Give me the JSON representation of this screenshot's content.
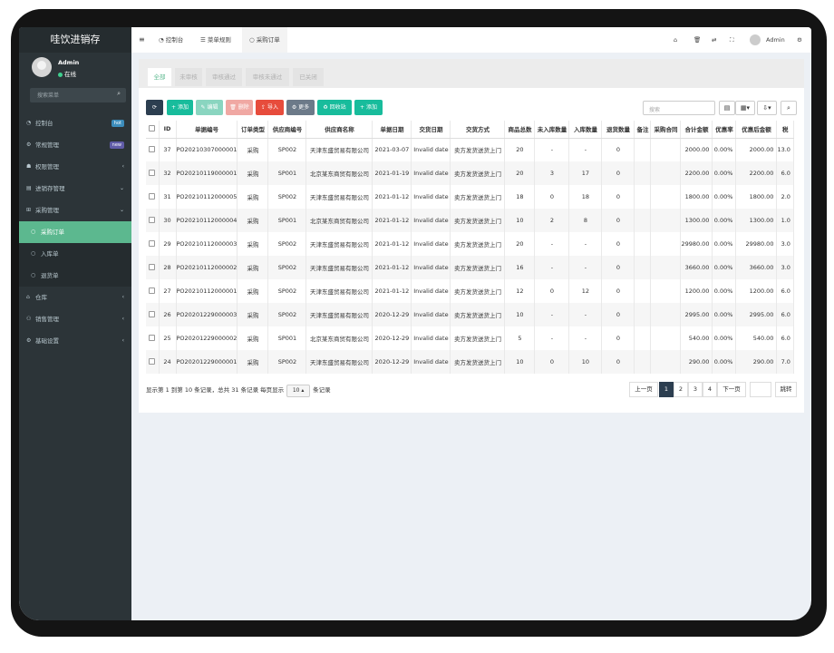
{
  "app": {
    "title": "哇饮进销存"
  },
  "user": {
    "name": "Admin",
    "status": "在线"
  },
  "sidebar": {
    "search_placeholder": "搜索菜单",
    "items": [
      {
        "label": "控制台",
        "badge": "hot",
        "badge_color": "#3c8dbc"
      },
      {
        "label": "常规管理",
        "badge": "new",
        "badge_color": "#605ca8"
      },
      {
        "label": "权限管理",
        "arrow": "‹"
      },
      {
        "label": "进销存管理",
        "arrow": "⌄"
      },
      {
        "label": "采购管理",
        "arrow": "⌄"
      }
    ],
    "subitems": [
      {
        "label": "采购订单"
      },
      {
        "label": "入库单"
      },
      {
        "label": "退货单"
      }
    ],
    "items2": [
      {
        "label": "仓库",
        "arrow": "‹"
      },
      {
        "label": "销售管理",
        "arrow": "‹"
      },
      {
        "label": "基础设置",
        "arrow": "‹"
      }
    ]
  },
  "topbar": {
    "menu_icon": "≡",
    "tabs": [
      "控制台",
      "菜单规则",
      "采购订单"
    ],
    "user": "Admin"
  },
  "filter_tabs": [
    "全部",
    "未审核",
    "审核通过",
    "审核未通过",
    "已关闭"
  ],
  "toolbar": {
    "buttons": [
      {
        "label": "",
        "icon": "refresh-icon",
        "color": "#2c3e50"
      },
      {
        "label": "添加",
        "icon": "+",
        "color": "#18bc9c"
      },
      {
        "label": "编辑",
        "icon": "✎",
        "color": "#8ad5c0"
      },
      {
        "label": "删除",
        "icon": "🗑",
        "color": "#f0a8a3"
      },
      {
        "label": "导入",
        "icon": "⇪",
        "color": "#e74c3c"
      },
      {
        "label": "更多",
        "icon": "⚙",
        "color": "#6c7a89"
      },
      {
        "label": "回收站",
        "icon": "♻",
        "color": "#18bc9c"
      },
      {
        "label": "添加",
        "icon": "+",
        "color": "#18bc9c"
      }
    ],
    "search_placeholder": "搜索"
  },
  "table": {
    "columns": [
      "ID",
      "单据编号",
      "订单类型",
      "供应商编号",
      "供应商名称",
      "单据日期",
      "交货日期",
      "交货方式",
      "商品总数",
      "未入库数量",
      "入库数量",
      "退货数量",
      "备注",
      "采购合同",
      "合计金额",
      "优惠率",
      "优惠后金额",
      "税"
    ],
    "rows": [
      [
        "37",
        "PO20210307000001",
        "采购",
        "SP002",
        "天津东盛贸易有限公司",
        "2021-03-07",
        "Invalid date",
        "卖方发货送货上门",
        "20",
        "-",
        "-",
        "0",
        "",
        "",
        "2000.00",
        "0.00%",
        "2000.00",
        "13.0"
      ],
      [
        "32",
        "PO20210119000001",
        "采购",
        "SP001",
        "北京某东商贸有限公司",
        "2021-01-19",
        "Invalid date",
        "卖方发货送货上门",
        "20",
        "3",
        "17",
        "0",
        "",
        "",
        "2200.00",
        "0.00%",
        "2200.00",
        "6.0"
      ],
      [
        "31",
        "PO20210112000005",
        "采购",
        "SP002",
        "天津东盛贸易有限公司",
        "2021-01-12",
        "Invalid date",
        "卖方发货送货上门",
        "18",
        "0",
        "18",
        "0",
        "",
        "",
        "1800.00",
        "0.00%",
        "1800.00",
        "2.0"
      ],
      [
        "30",
        "PO20210112000004",
        "采购",
        "SP001",
        "北京某东商贸有限公司",
        "2021-01-12",
        "Invalid date",
        "卖方发货送货上门",
        "10",
        "2",
        "8",
        "0",
        "",
        "",
        "1300.00",
        "0.00%",
        "1300.00",
        "1.0"
      ],
      [
        "29",
        "PO20210112000003",
        "采购",
        "SP002",
        "天津东盛贸易有限公司",
        "2021-01-12",
        "Invalid date",
        "卖方发货送货上门",
        "20",
        "-",
        "-",
        "0",
        "",
        "",
        "29980.00",
        "0.00%",
        "29980.00",
        "3.0"
      ],
      [
        "28",
        "PO20210112000002",
        "采购",
        "SP002",
        "天津东盛贸易有限公司",
        "2021-01-12",
        "Invalid date",
        "卖方发货送货上门",
        "16",
        "-",
        "-",
        "0",
        "",
        "",
        "3660.00",
        "0.00%",
        "3660.00",
        "3.0"
      ],
      [
        "27",
        "PO20210112000001",
        "采购",
        "SP002",
        "天津东盛贸易有限公司",
        "2021-01-12",
        "Invalid date",
        "卖方发货送货上门",
        "12",
        "0",
        "12",
        "0",
        "",
        "",
        "1200.00",
        "0.00%",
        "1200.00",
        "6.0"
      ],
      [
        "26",
        "PO20201229000003",
        "采购",
        "SP002",
        "天津东盛贸易有限公司",
        "2020-12-29",
        "Invalid date",
        "卖方发货送货上门",
        "10",
        "-",
        "-",
        "0",
        "",
        "",
        "2995.00",
        "0.00%",
        "2995.00",
        "6.0"
      ],
      [
        "25",
        "PO20201229000002",
        "采购",
        "SP001",
        "北京某东商贸有限公司",
        "2020-12-29",
        "Invalid date",
        "卖方发货送货上门",
        "5",
        "-",
        "-",
        "0",
        "",
        "",
        "540.00",
        "0.00%",
        "540.00",
        "6.0"
      ],
      [
        "24",
        "PO20201229000001",
        "采购",
        "SP002",
        "天津东盛贸易有限公司",
        "2020-12-29",
        "Invalid date",
        "卖方发货送货上门",
        "10",
        "0",
        "10",
        "0",
        "",
        "",
        "290.00",
        "0.00%",
        "290.00",
        "7.0"
      ]
    ]
  },
  "footer": {
    "summary": "显示第 1 到第 10 条记录，总共 31 条记录 每页显示",
    "page_size": "10",
    "suffix": "条记录",
    "prev": "上一页",
    "pages": [
      "1",
      "2",
      "3",
      "4"
    ],
    "next": "下一页",
    "jump": "跳转"
  }
}
